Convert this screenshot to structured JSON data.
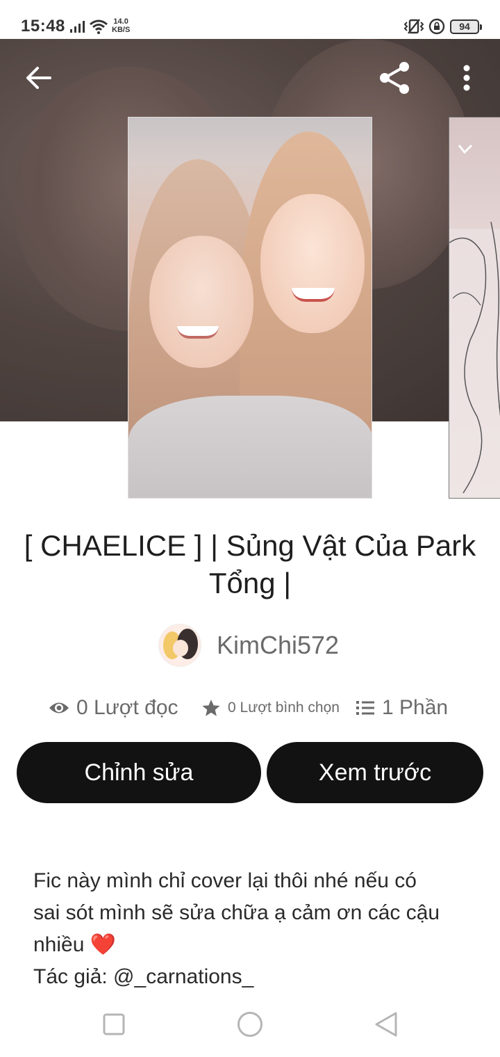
{
  "status_bar": {
    "time": "15:48",
    "net_speed_value": "14.0",
    "net_speed_unit": "KB/S",
    "battery": "94",
    "icons": [
      "signal-icon",
      "wifi-icon",
      "vibrate-icon",
      "lock-rotation-icon",
      "battery-icon"
    ]
  },
  "toolbar": {
    "icons": [
      "back-arrow-icon",
      "share-icon",
      "more-vert-icon"
    ]
  },
  "story": {
    "title": "[ CHAELICE ] | Sủng Vật Của Park Tổng |",
    "author": "KimChi572",
    "stats": {
      "reads": "0 Lượt đọc",
      "votes": "0 Lượt bình chọn",
      "parts": "1 Phần"
    },
    "buttons": {
      "edit": "Chỉnh sửa",
      "preview": "Xem trước"
    },
    "description": {
      "line1": "Fic này mình chỉ cover lại thôi nhé nếu có",
      "line2": "sai sót mình sẽ sửa chữa ạ cảm ơn các cậu",
      "line3": "nhiều",
      "heart": "❤️",
      "line4": "Tác giả: @_carnations_"
    }
  },
  "nav_bar": {
    "icons": [
      "recents-icon",
      "home-icon",
      "back-icon"
    ]
  },
  "colors": {
    "button_bg": "#121212",
    "button_text": "#ffffff",
    "muted_text": "#6a6a6a",
    "heart": "#e0222a"
  }
}
